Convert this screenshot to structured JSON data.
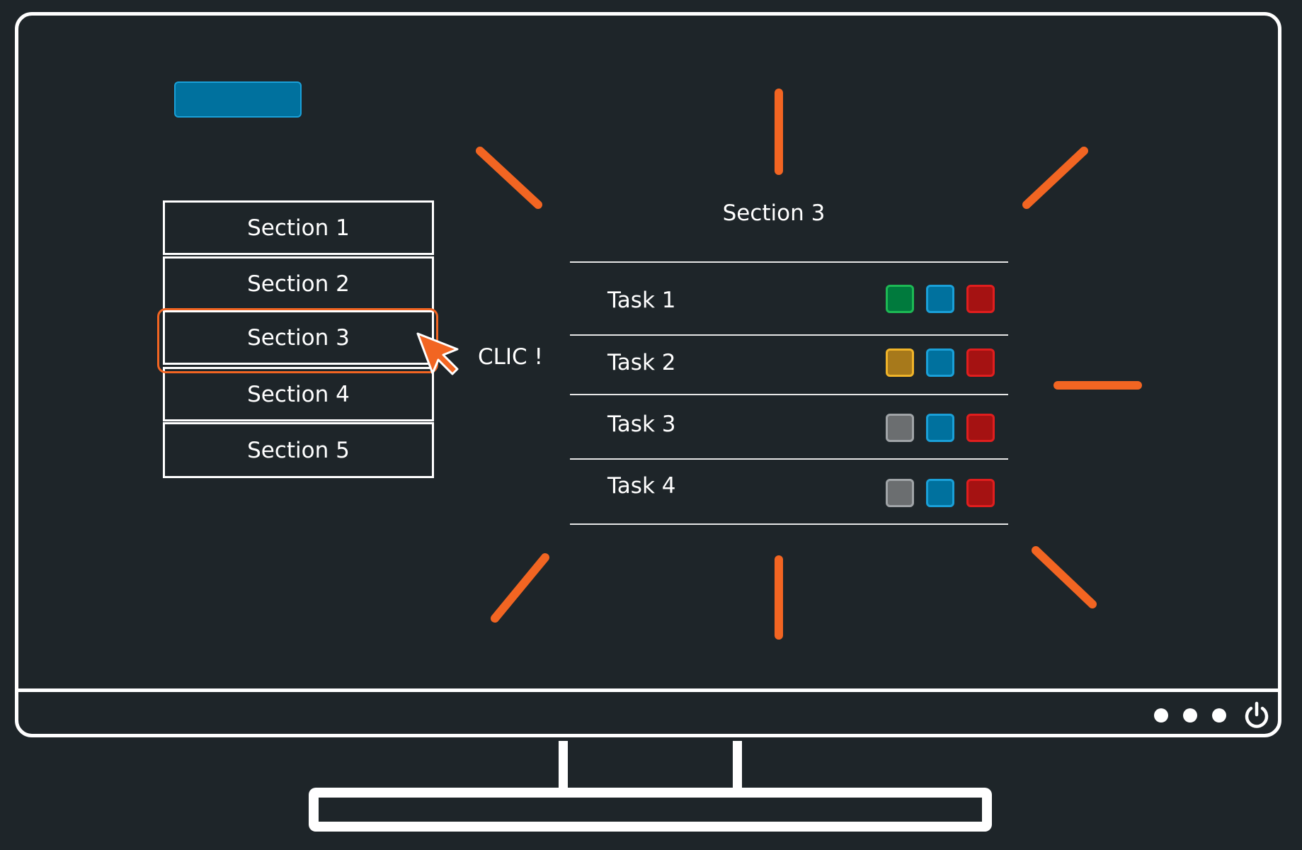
{
  "sections": [
    "Section 1",
    "Section 2",
    "Section 3",
    "Section 4",
    "Section 5"
  ],
  "selected_section": "Section 3",
  "click_label": "CLIC !",
  "panel": {
    "title": "Section 3",
    "tasks": [
      {
        "label": "Task 1",
        "status": [
          "green",
          "blue",
          "red"
        ]
      },
      {
        "label": "Task 2",
        "status": [
          "yellow",
          "blue",
          "red"
        ]
      },
      {
        "label": "Task 3",
        "status": [
          "gray",
          "blue",
          "red"
        ]
      },
      {
        "label": "Task 4",
        "status": [
          "gray",
          "blue",
          "red"
        ]
      }
    ]
  },
  "colors": {
    "background": "#1e2529",
    "accent_orange": "#f26522",
    "green": "#007a3d",
    "green_border": "#1db954",
    "blue": "#00719e",
    "blue_border": "#1aa0d8",
    "red": "#a51212",
    "red_border": "#e01e1e",
    "yellow": "#a7791b",
    "yellow_border": "#f0b429",
    "gray": "#6b6e70",
    "gray_border": "#a0a4a7"
  },
  "icons": [
    "pointer-cursor-icon",
    "power-icon"
  ]
}
